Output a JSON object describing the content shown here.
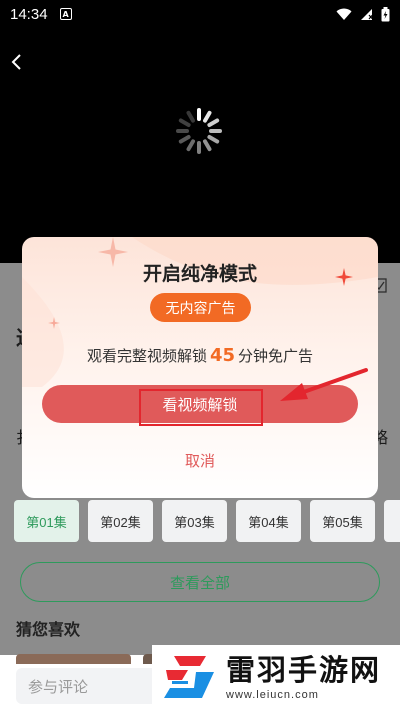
{
  "status_bar": {
    "time": "14:34",
    "app_badge": "A"
  },
  "dialog": {
    "title": "开启纯净模式",
    "badge": "无内容广告",
    "desc_prefix": "观看完整视频解锁",
    "desc_minutes": "45",
    "desc_suffix": "分钟免广告",
    "unlock_label": "看视频解锁",
    "cancel_label": "取消"
  },
  "episodes": [
    "第01集",
    "第02集",
    "第03集",
    "第04集",
    "第05集"
  ],
  "view_all": "查看全部",
  "section_title": "猜您喜欢",
  "comment_placeholder": "参与评论",
  "watermark": {
    "title": "雷羽手游网",
    "url": "www.leiucn.com"
  },
  "under_dialog": {
    "left_char_1": "过",
    "left_char_2": "扌",
    "right_char": "略"
  },
  "colors": {
    "accent_green": "#2e9a5c",
    "unlock_red": "#e05a5a",
    "badge_orange": "#f26a24",
    "annotation_red": "#e3262e"
  }
}
